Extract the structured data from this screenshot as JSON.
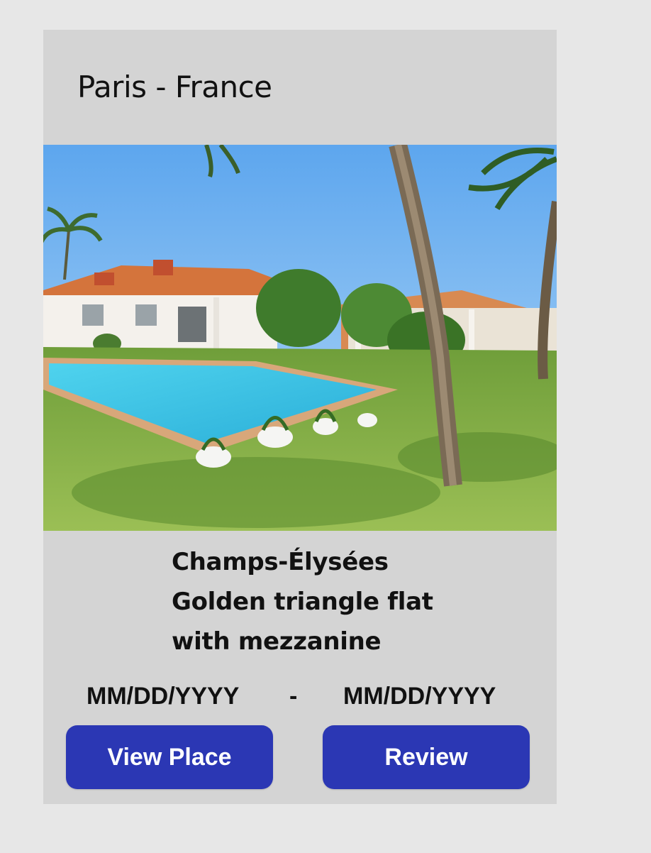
{
  "listing": {
    "location": "Paris - France",
    "title_lines": [
      "Champs-Élysées",
      "Golden triangle flat",
      "with mezzanine"
    ],
    "start_date": "MM/DD/YYYY",
    "date_separator": "-",
    "end_date": "MM/DD/YYYY",
    "view_place_label": "View Place",
    "review_label": "Review"
  },
  "colors": {
    "page_background": "#e7e7e7",
    "card_background": "#d4d4d4",
    "button": "#2b37b4",
    "button_text": "#ffffff"
  }
}
